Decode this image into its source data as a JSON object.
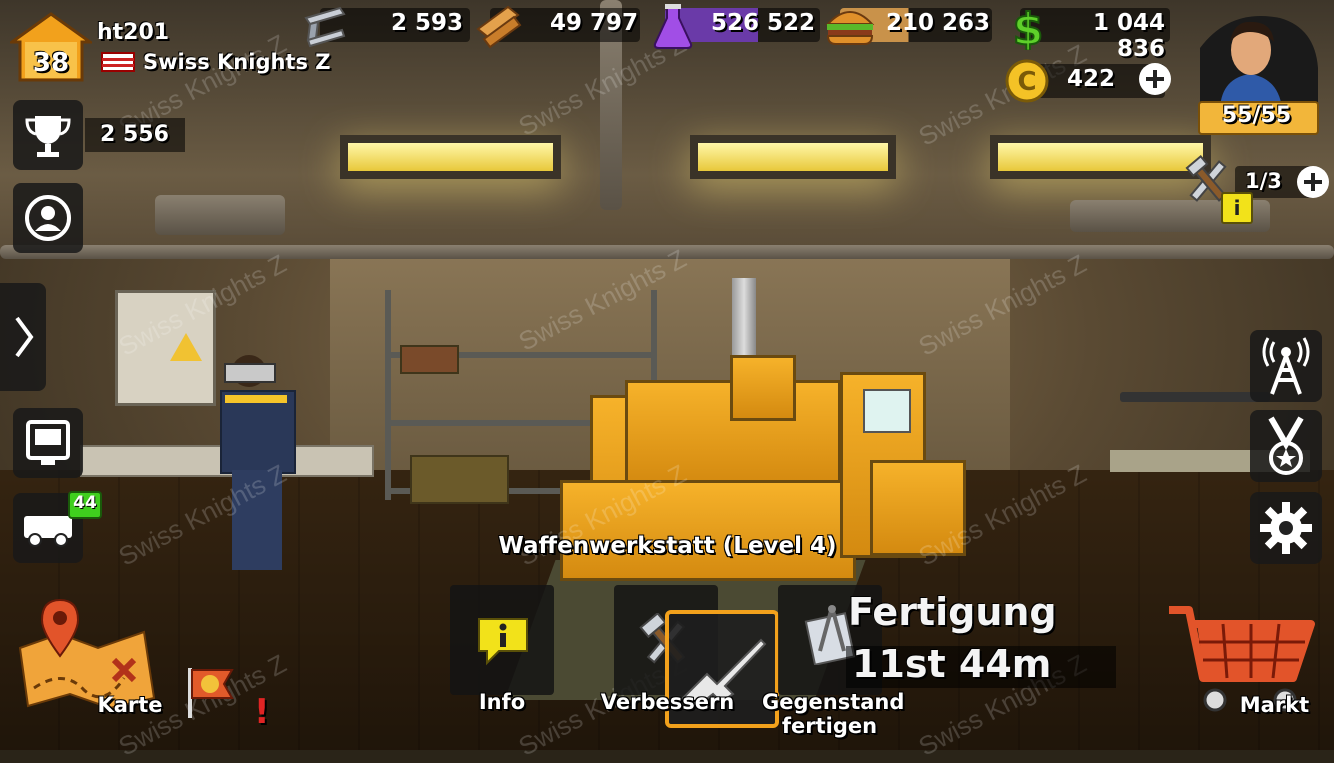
{
  "player": {
    "level": "38",
    "name": "ht201",
    "clan": "Swiss Knights Z",
    "trophies": "2 556"
  },
  "resources": {
    "steel": "2 593",
    "wood": "49 797",
    "chemicals": "526 522",
    "food": "210 263",
    "money": "1 044 836",
    "coins": "422"
  },
  "hero": {
    "energy": "55/55"
  },
  "builders": {
    "count": "1/3"
  },
  "building": {
    "title": "Waffenwerkstatt (Level 4)"
  },
  "production": {
    "label": "Fertigung",
    "timer": "11st 44m"
  },
  "garage": {
    "badge": "44"
  },
  "actions": {
    "info": "Info",
    "upgrade": "Verbessern",
    "craft": "Gegenstand fertigen"
  },
  "nav": {
    "map": "Karte",
    "alert": "!",
    "market": "Markt"
  },
  "watermark": "Swiss Knights Z",
  "colors": {
    "accent": "#f2b63a",
    "info_yellow": "#f2e21a",
    "badge_green": "#3fcf1e",
    "alert_red": "#e02424"
  }
}
